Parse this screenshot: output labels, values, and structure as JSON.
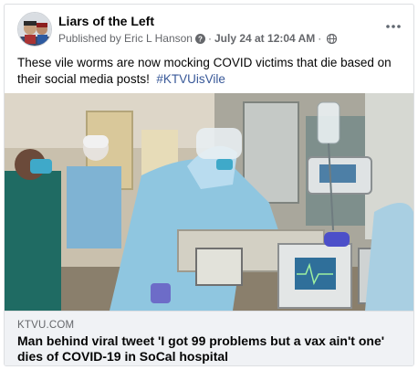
{
  "post": {
    "page_name": "Liars of the Left",
    "published_by": "Published by Eric L Hanson",
    "date": "July 24 at 12:04 AM",
    "separator": "·",
    "more_icon": "ellipsis-icon",
    "help_icon": "question-circle-icon",
    "audience_icon": "globe-icon",
    "text": "These vile worms are now mocking COVID victims that die based on their social media posts!",
    "hashtag": "#KTVUisVile"
  },
  "link_preview": {
    "domain": "KTVU.COM",
    "title": "Man behind viral tweet 'I got 99 problems but a vax ain't one' dies of COVID-19 in SoCal hospital"
  },
  "colors": {
    "hashtag": "#385898",
    "secondary_text": "#65676b",
    "footer_bg": "#f0f2f5"
  }
}
